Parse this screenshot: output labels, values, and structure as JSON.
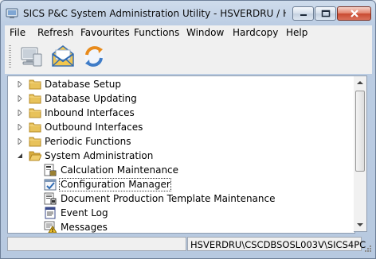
{
  "window": {
    "title": "SICS P&C System Administration Utility -  HSVERDRU / Haral"
  },
  "menu": [
    {
      "label": "File"
    },
    {
      "label": "Refresh"
    },
    {
      "label": "Favourites"
    },
    {
      "label": "Functions"
    },
    {
      "label": "Window"
    },
    {
      "label": "Hardcopy"
    },
    {
      "label": "Help"
    }
  ],
  "toolbar": {
    "buttons": [
      {
        "icon": "computer-icon"
      },
      {
        "icon": "mail-icon"
      },
      {
        "icon": "refresh-icon"
      }
    ]
  },
  "tree": {
    "folders": [
      {
        "label": "Database Setup",
        "expanded": false
      },
      {
        "label": "Database Updating",
        "expanded": false
      },
      {
        "label": "Inbound Interfaces",
        "expanded": false
      },
      {
        "label": "Outbound Interfaces",
        "expanded": false
      },
      {
        "label": "Periodic Functions",
        "expanded": false
      },
      {
        "label": "System Administration",
        "expanded": true
      }
    ],
    "children": [
      {
        "label": "Calculation Maintenance",
        "icon": "calculator-document-icon"
      },
      {
        "label": "Configuration Manager",
        "icon": "checklist-icon",
        "selected": true
      },
      {
        "label": "Document Production Template Maintenance",
        "icon": "template-document-icon"
      },
      {
        "label": "Event Log",
        "icon": "log-icon"
      },
      {
        "label": "Messages",
        "icon": "message-warning-icon"
      }
    ]
  },
  "status": {
    "pane1": "",
    "pane2": "HSVERDRU\\CSCDBSOSL003V\\SICS4PC"
  },
  "colors": {
    "folder": "#e8c25a",
    "accent": "#2f6bb3"
  }
}
